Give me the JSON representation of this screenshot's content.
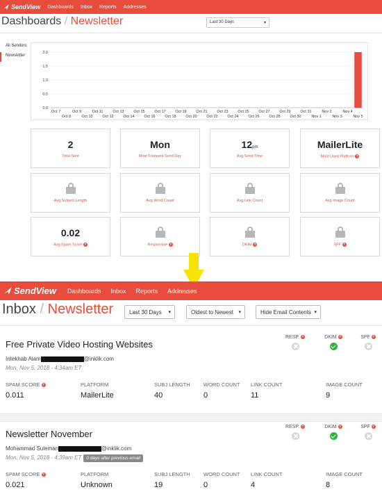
{
  "top": {
    "brand": "SendView",
    "nav": [
      "Dashboards",
      "Inbox",
      "Reports",
      "Addresses"
    ],
    "title": "Dashboards",
    "title_sep": "/",
    "title_accent": "Newsletter",
    "date_range": "Last 30 Days",
    "sidebar": [
      "All Senders",
      "Newsletter"
    ],
    "accent_color": "#e84c3d",
    "chart_data": {
      "type": "bar",
      "categories": [
        "Oct 7",
        "Oct 8",
        "Oct 9",
        "Oct 10",
        "Oct 11",
        "Oct 12",
        "Oct 13",
        "Oct 14",
        "Oct 15",
        "Oct 16",
        "Oct 17",
        "Oct 18",
        "Oct 19",
        "Oct 20",
        "Oct 21",
        "Oct 22",
        "Oct 23",
        "Oct 24",
        "Oct 25",
        "Oct 26",
        "Oct 27",
        "Oct 28",
        "Oct 29",
        "Oct 30",
        "Oct 31",
        "Nov 1",
        "Nov 2",
        "Nov 3",
        "Nov 4",
        "Nov 5"
      ],
      "values": [
        0,
        0,
        0,
        0,
        0,
        0,
        0,
        0,
        0,
        0,
        0,
        0,
        0,
        0,
        0,
        0,
        0,
        0,
        0,
        0,
        0,
        0,
        0,
        0,
        0,
        0,
        0,
        0,
        0,
        2
      ],
      "y_ticks": [
        "0.0",
        "0.5",
        "1.0",
        "1.5",
        "2.0"
      ],
      "ylim": [
        0,
        2
      ],
      "grid": true
    },
    "stats": [
      {
        "value": "2",
        "value_unit": "",
        "label": "Total Sent",
        "locked": false,
        "help": false
      },
      {
        "value": "Mon",
        "value_unit": "",
        "label": "Most Frequent Send Day",
        "locked": false,
        "help": false
      },
      {
        "value": "12",
        "value_unit": "pm",
        "label": "Avg Send Time",
        "locked": false,
        "help": false
      },
      {
        "value": "MailerLite",
        "value_unit": "",
        "label": "Most Used Platform",
        "locked": false,
        "help": true
      },
      {
        "value": "",
        "value_unit": "",
        "label": "Avg Subject Length",
        "locked": true,
        "help": false
      },
      {
        "value": "",
        "value_unit": "",
        "label": "Avg Word Count",
        "locked": true,
        "help": false
      },
      {
        "value": "",
        "value_unit": "",
        "label": "Avg Link Count",
        "locked": true,
        "help": false
      },
      {
        "value": "",
        "value_unit": "",
        "label": "Avg Image Count",
        "locked": true,
        "help": false
      },
      {
        "value": "0.02",
        "value_unit": "",
        "label": "Avg Spam Score",
        "locked": false,
        "help": true
      },
      {
        "value": "",
        "value_unit": "",
        "label": "Responsive",
        "locked": true,
        "help": true
      },
      {
        "value": "",
        "value_unit": "",
        "label": "DKIM",
        "locked": true,
        "help": true
      },
      {
        "value": "",
        "value_unit": "",
        "label": "SPF",
        "locked": true,
        "help": true
      }
    ]
  },
  "bottom": {
    "brand": "SendView",
    "nav": [
      "Dashboards",
      "Inbox",
      "Reports",
      "Addresses"
    ],
    "title": "Inbox",
    "title_sep": "/",
    "title_accent": "Newsletter",
    "filters": [
      "Last 30 Days",
      "Oldest to Newest",
      "Hide Email Contents"
    ],
    "check_labels": [
      "RESP.",
      "DKIM",
      "SPF"
    ],
    "metric_labels": [
      "SPAM SCORE",
      "PLATFORM",
      "SUBJ LENGTH",
      "WORD COUNT",
      "LINK COUNT",
      "IMAGE COUNT"
    ],
    "emails": [
      {
        "subject": "Free Private Video Hosting Websites",
        "from_name": "Intekhab Alam",
        "from_domain": "@inklik.com",
        "date": "Mon, Nov 5, 2018 - 4:34am ET",
        "gap": "",
        "checks": [
          "fail",
          "pass",
          "fail"
        ],
        "metrics": [
          "0.011",
          "MailerLite",
          "40",
          "0",
          "11",
          "9"
        ]
      },
      {
        "subject": "Newsletter November",
        "from_name": "Mohammad Suleman",
        "from_domain": "@inklik.com",
        "date": "Mon, Nov 5, 2018 - 4:39am ET",
        "gap": "0 days after previous email",
        "checks": [
          "fail",
          "pass",
          "fail"
        ],
        "metrics": [
          "0.021",
          "Unknown",
          "19",
          "0",
          "4",
          "8"
        ]
      }
    ]
  }
}
